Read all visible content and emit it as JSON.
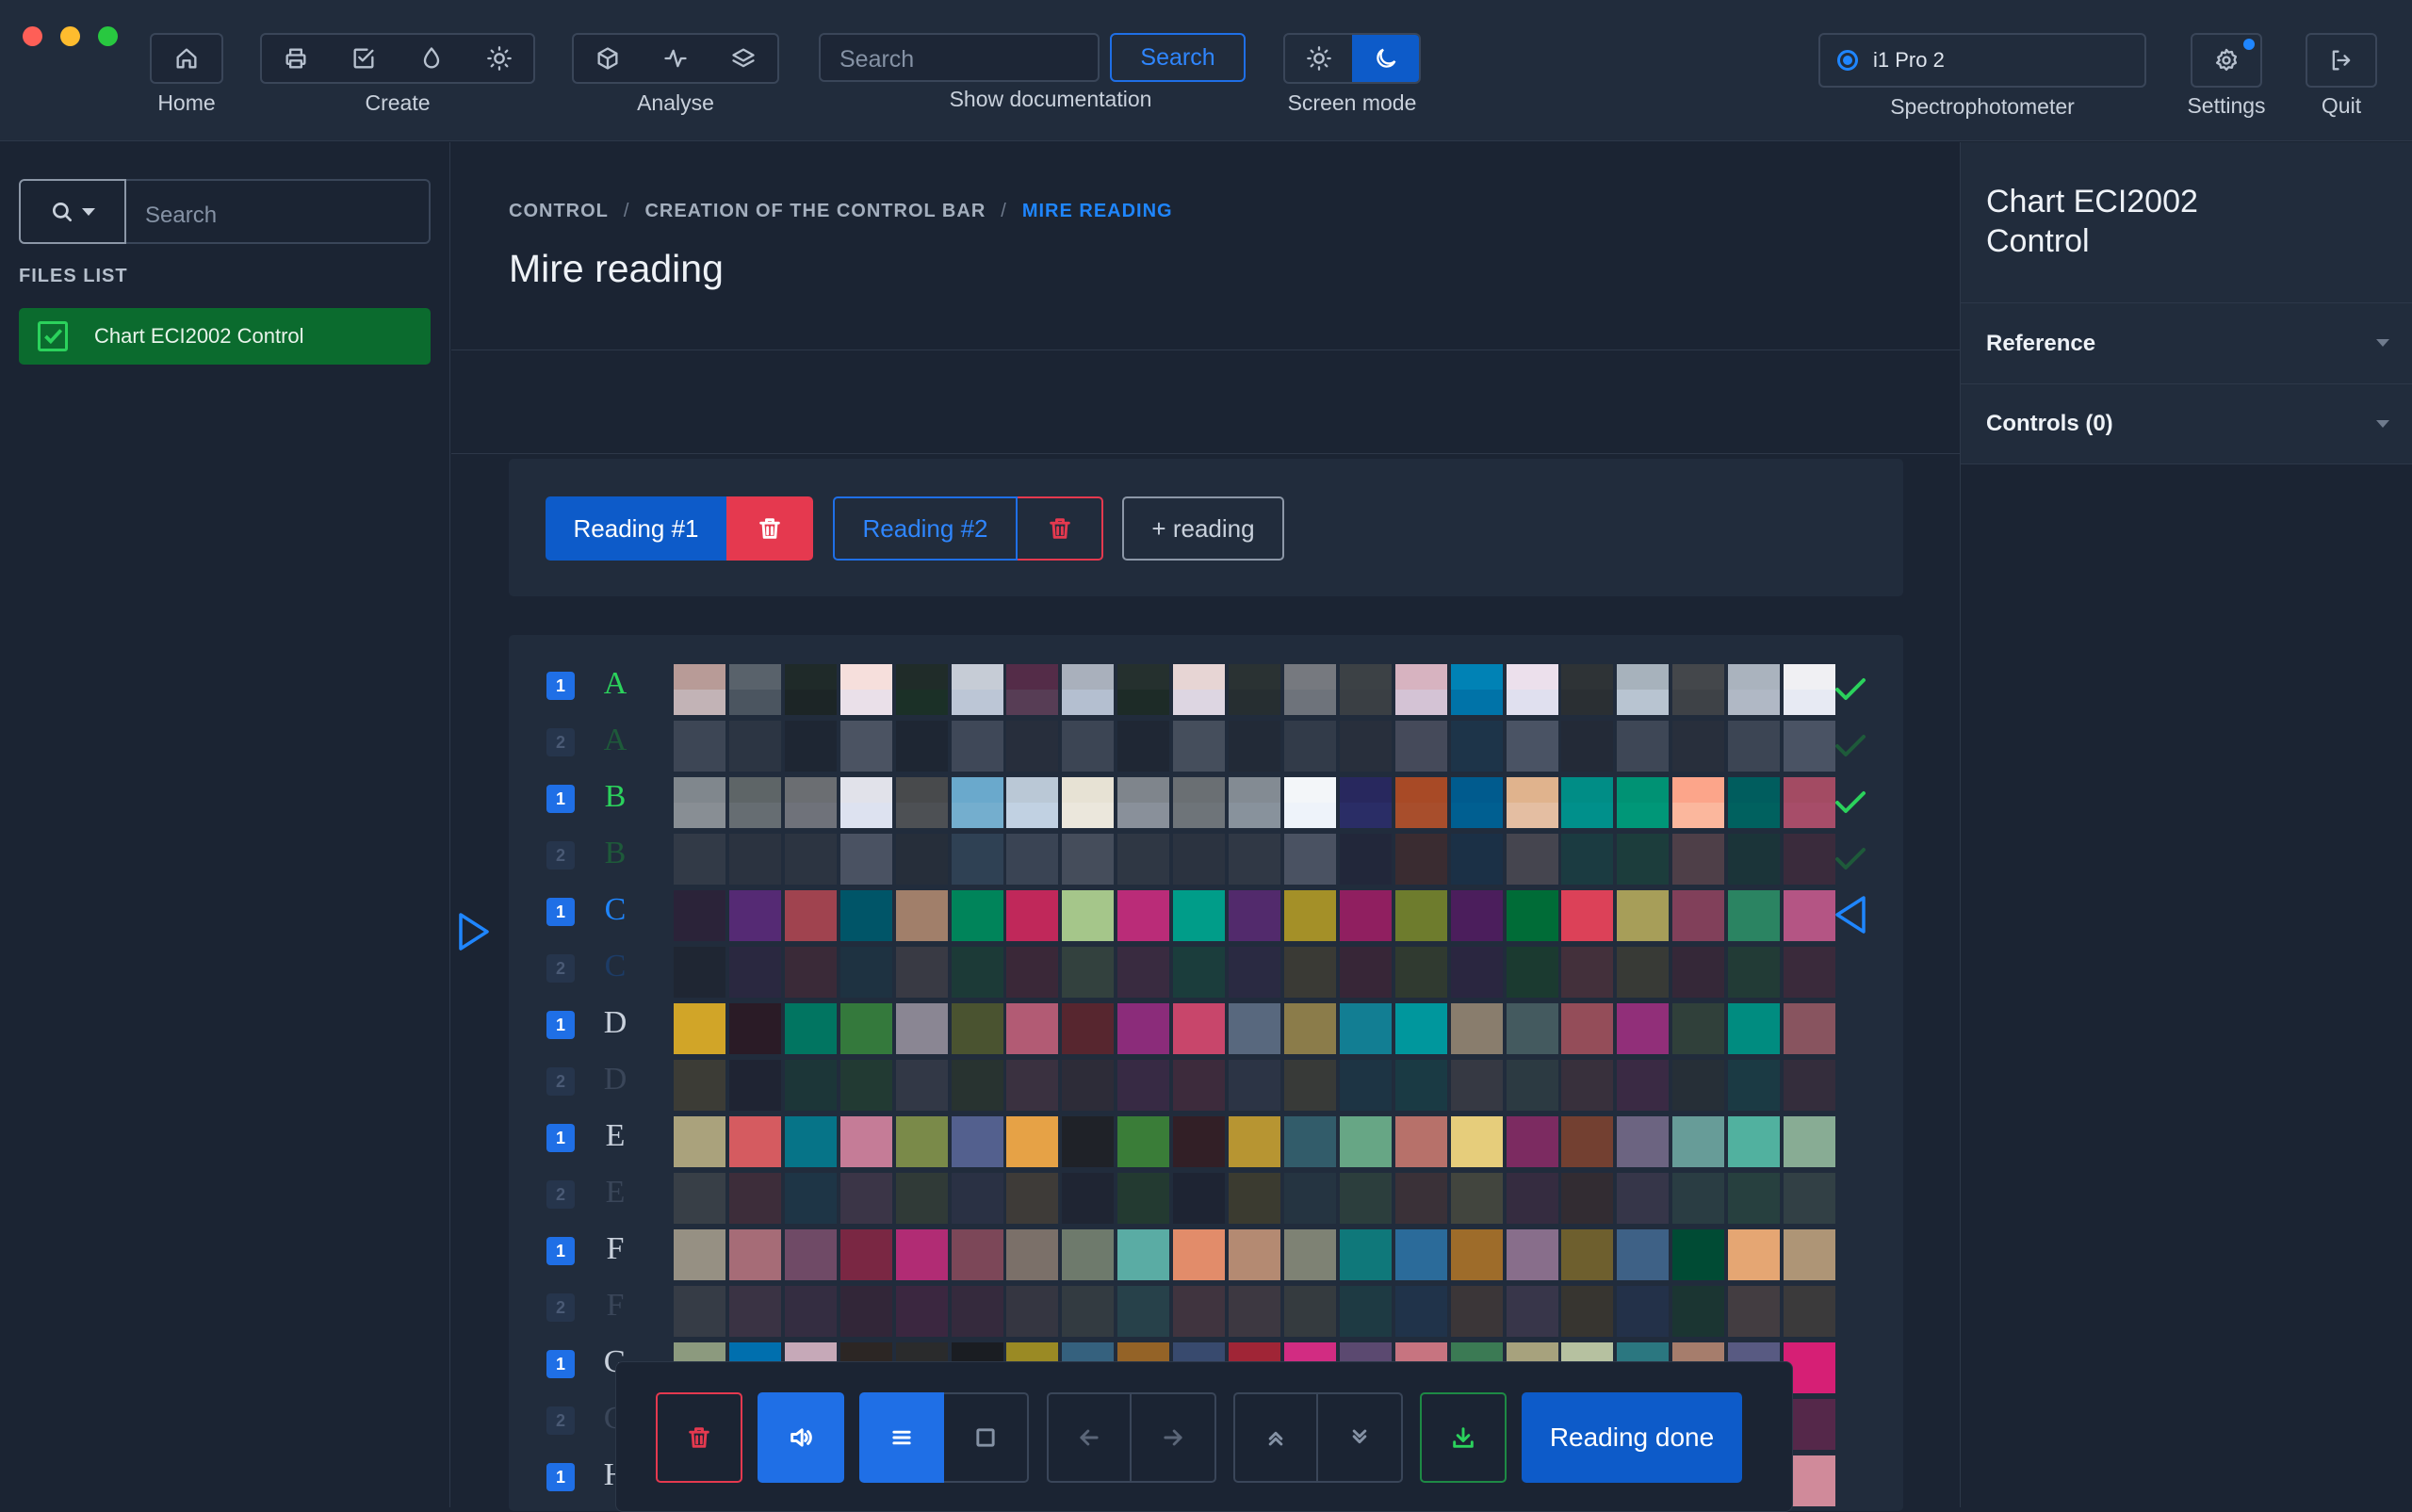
{
  "topbar": {
    "home_label": "Home",
    "create_label": "Create",
    "analyse_label": "Analyse",
    "search_placeholder": "Search",
    "search_button": "Search",
    "show_doc_label": "Show documentation",
    "screen_mode_label": "Screen mode",
    "spectro_value": "i1 Pro 2",
    "spectro_label": "Spectrophotometer",
    "settings_label": "Settings",
    "quit_label": "Quit"
  },
  "sidebar": {
    "search_placeholder": "Search",
    "files_title": "FILES LIST",
    "files": [
      {
        "name": "Chart ECI2002 Control"
      }
    ]
  },
  "breadcrumb": {
    "items": [
      "CONTROL",
      "CREATION OF THE CONTROL BAR",
      "MIRE READING"
    ]
  },
  "page_title": "Mire reading",
  "readings": {
    "reading1": "Reading #1",
    "reading2": "Reading #2",
    "add": "+ reading"
  },
  "chart": {
    "rows": [
      {
        "letter": "A",
        "pass": "1",
        "status": "done",
        "colors": [
          "#b89b97",
          "#59626b",
          "#1f2a29",
          "#f6dfdc",
          "#202c29",
          "#c6ccd6",
          "#542c48",
          "#a9b0bc",
          "#25302e",
          "#e7d5d4",
          "#2a3233",
          "#76797f",
          "#3c4145",
          "#d7b3c0",
          "#0082b5",
          "#ece0ec",
          "#2e3336",
          "#a7b2bc",
          "#44474b",
          "#aab3be",
          "#f0f0f3"
        ],
        "bottoms": [
          "#c2b3b6",
          "#4b5560",
          "#1c2526",
          "#eae0e9",
          "#1b3027",
          "#bcc6d6",
          "#573d55",
          "#b4bfd0",
          "#1d2b27",
          "#ddd6e2",
          "#262e31",
          "#6e737b",
          "#3a3f44",
          "#d4c3d5",
          "#0073a8",
          "#e0e0ef",
          "#2a2f33",
          "#b8c4d1",
          "#3e4247",
          "#b0b8c5",
          "#e7eaf3"
        ]
      },
      {
        "letter": "A",
        "pass": "2",
        "status": "faded",
        "colors": [
          "#3d4655",
          "#2c3543",
          "#1e2633",
          "#4b5362",
          "#1e2633",
          "#3f4858",
          "#272e3c",
          "#3c4554",
          "#1f2734",
          "#454e5c",
          "#222a37",
          "#323b49",
          "#282f3c",
          "#454a5a",
          "#1d3449",
          "#4a5364",
          "#232a37",
          "#3e4756",
          "#282f3c",
          "#3c4554",
          "#4a5364"
        ],
        "bottoms": []
      },
      {
        "letter": "B",
        "pass": "1",
        "status": "done",
        "colors": [
          "#80878d",
          "#5e6567",
          "#6b6e72",
          "#e1e2ea",
          "#484a4c",
          "#6aa9cc",
          "#bac8d6",
          "#e7e2d4",
          "#7f858c",
          "#6a6f73",
          "#838b93",
          "#f3f6f9",
          "#28285e",
          "#a84a26",
          "#005b8e",
          "#e0b38d",
          "#008d86",
          "#009274",
          "#fca58a",
          "#005d5e",
          "#a34b63"
        ],
        "bottoms": [
          "#888e94",
          "#666d72",
          "#6f727a",
          "#dde2f0",
          "#4d5054",
          "#74aece",
          "#c1d1e2",
          "#ebe7dc",
          "#89909a",
          "#6e7479",
          "#88929c",
          "#eef3fa",
          "#2a2d66",
          "#a84e2c",
          "#005f91",
          "#e4bea2",
          "#00908b",
          "#009778",
          "#fbb79d",
          "#00615f",
          "#a74d69"
        ]
      },
      {
        "letter": "B",
        "pass": "2",
        "status": "faded",
        "colors": [
          "#323a47",
          "#2b3340",
          "#2c3441",
          "#4a5262",
          "#262e3a",
          "#2f4154",
          "#3a4454",
          "#454d5b",
          "#2f3744",
          "#2b3340",
          "#303845",
          "#4a5262",
          "#22273a",
          "#3a2c31",
          "#1b3046",
          "#45454f",
          "#1b3b41",
          "#1c3d3c",
          "#4e3f48",
          "#1b3439",
          "#3a2b3c"
        ],
        "bottoms": []
      },
      {
        "letter": "C",
        "pass": "1",
        "status": "current",
        "colors": [
          "#2b2339",
          "#552a74",
          "#a0434f",
          "#005568",
          "#a17f6a",
          "#00845a",
          "#c0285a",
          "#a5c68a",
          "#ba2c78",
          "#009d89",
          "#522a6c",
          "#a49028",
          "#901f60",
          "#6e7c2d",
          "#4b1e5c",
          "#006c37",
          "#dc4158",
          "#a79e59",
          "#81405a",
          "#2b8462",
          "#b45584"
        ],
        "bottoms": []
      },
      {
        "letter": "C",
        "pass": "2",
        "status": "faded",
        "colors": [
          "#1f2633",
          "#2a2840",
          "#3a2a38",
          "#1e3241",
          "#393a44",
          "#1c3a37",
          "#3a2838",
          "#33413e",
          "#392b40",
          "#1b3d3c",
          "#2a2a42",
          "#3a3a35",
          "#372637",
          "#303a30",
          "#2a2640",
          "#1b3a30",
          "#43303b",
          "#383a36",
          "#352838",
          "#223b36",
          "#3a2a3b"
        ],
        "bottoms": []
      },
      {
        "letter": "D",
        "pass": "1",
        "status": "pending",
        "colors": [
          "#d1a528",
          "#2a1b26",
          "#017561",
          "#34793c",
          "#8a8693",
          "#4a5330",
          "#b25b74",
          "#57262f",
          "#8b2c7a",
          "#c8466b",
          "#58687e",
          "#8b7c4a",
          "#127e93",
          "#00979d",
          "#897d6d",
          "#445a5f",
          "#944d59",
          "#912f79",
          "#30403a",
          "#008c80",
          "#88545f"
        ],
        "bottoms": []
      },
      {
        "letter": "D",
        "pass": "2",
        "status": "faded",
        "colors": [
          "#3c3c36",
          "#1f2433",
          "#1c3638",
          "#223a33",
          "#323846",
          "#283330",
          "#3a3140",
          "#2d2c38",
          "#372a44",
          "#3d2b3c",
          "#2c3445",
          "#383a38",
          "#1d3444",
          "#1a3a44",
          "#363943",
          "#2c3a42",
          "#38303c",
          "#3a2a44",
          "#262f37",
          "#1b3a44",
          "#342d3c"
        ],
        "bottoms": []
      },
      {
        "letter": "E",
        "pass": "1",
        "status": "pending",
        "colors": [
          "#aaa27c",
          "#d55b60",
          "#067488",
          "#c57c97",
          "#7a8a49",
          "#53608e",
          "#e6a246",
          "#1f2228",
          "#3a7d38",
          "#321f26",
          "#b79532",
          "#325c6a",
          "#67a685",
          "#b7716a",
          "#e6cd7b",
          "#7c2b61",
          "#734031",
          "#6c6481",
          "#679c98",
          "#51b19f",
          "#88ac94"
        ],
        "bottoms": []
      },
      {
        "letter": "E",
        "pass": "2",
        "status": "faded",
        "colors": [
          "#383f47",
          "#3d2d3a",
          "#1e3546",
          "#3b3547",
          "#303a37",
          "#2a3144",
          "#3e3b38",
          "#1f2533",
          "#233a31",
          "#1e2433",
          "#3b3b30",
          "#253441",
          "#2c3e3d",
          "#3a3138",
          "#42453e",
          "#352c40",
          "#322c32",
          "#363649",
          "#2a3d43",
          "#27403f",
          "#324045"
        ],
        "bottoms": []
      },
      {
        "letter": "F",
        "pass": "1",
        "status": "pending",
        "colors": [
          "#969083",
          "#a66c77",
          "#6f4a66",
          "#7a2743",
          "#b12c74",
          "#7c4758",
          "#7b7069",
          "#6e7a6c",
          "#5aaca4",
          "#e28c6a",
          "#b48a72",
          "#7e8274",
          "#0f787a",
          "#2b6b9a",
          "#9e6c2a",
          "#886e8b",
          "#6e5f2e",
          "#3e6186",
          "#004b34",
          "#e5a673",
          "#ae9576"
        ],
        "bottoms": []
      },
      {
        "letter": "F",
        "pass": "2",
        "status": "faded",
        "colors": [
          "#363c46",
          "#3a3344",
          "#342d41",
          "#322638",
          "#3b2740",
          "#352a3d",
          "#353641",
          "#333b41",
          "#27414a",
          "#40343f",
          "#3d3841",
          "#353b3f",
          "#1e3a43",
          "#20334a",
          "#3b3638",
          "#38364a",
          "#373530",
          "#233149",
          "#1b3532",
          "#433d41",
          "#3b3a3b"
        ],
        "bottoms": []
      },
      {
        "letter": "G",
        "pass": "1",
        "status": "pending",
        "colors": [
          "#8c9a7e",
          "#006fae",
          "#c6a9b8",
          "#2c2624",
          "#2a2b2c",
          "#1a1d22",
          "#9a8a24",
          "#35617e",
          "#946327",
          "#384a6e",
          "#a02536",
          "#d22c82",
          "#5b4970",
          "#c77480",
          "#3b7a54",
          "#a7a27d",
          "#b6c1a0",
          "#2b7780",
          "#a67d6c",
          "#585a82",
          "#d61f75"
        ],
        "bottoms": []
      },
      {
        "letter": "G",
        "pass": "2",
        "status": "faded",
        "colors": [
          "#2e3845",
          "#1e3344",
          "#3b3744",
          "#262a33",
          "#262a33",
          "#1d2230",
          "#383a33",
          "#22313f",
          "#3a3238",
          "#242c40",
          "#392a35",
          "#3e2a3e",
          "#2d2b40",
          "#3e303c",
          "#22392f",
          "#3a3b3b",
          "#3c4040",
          "#1c3838",
          "#3b333c",
          "#2a2c40",
          "#55284a"
        ],
        "bottoms": []
      },
      {
        "letter": "H",
        "pass": "1",
        "status": "pending",
        "colors": [
          "#3a3f4a",
          "#2a3140",
          "#3b3441",
          "#2a3038",
          "#2d3340",
          "#232a36",
          "#3b3a38",
          "#2a3646",
          "#3a3238",
          "#263043",
          "#3b2a35",
          "#402b42",
          "#2d2c45",
          "#3e3240",
          "#243b31",
          "#3b3c3a",
          "#3f4342",
          "#1d3c3c",
          "#3b3541",
          "#2b2d43",
          "#d08a9a"
        ],
        "bottoms": []
      }
    ]
  },
  "bottombar": {
    "reading_done": "Reading done"
  },
  "rightpanel": {
    "title_line1": "Chart ECI2002",
    "title_line2": "Control",
    "reference": "Reference",
    "controls": "Controls (0)"
  },
  "colors": {
    "accent": "#1f86ff",
    "primary_btn": "#0d5bc9",
    "danger": "#e5394f",
    "success": "#2bd25c",
    "file_bg": "#0b6b2e"
  }
}
